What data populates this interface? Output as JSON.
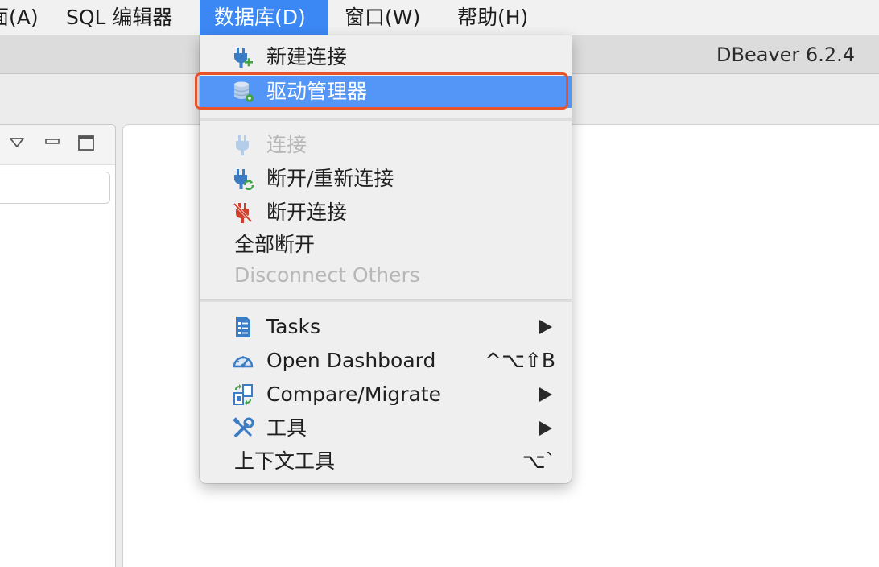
{
  "menubar": {
    "items": [
      {
        "label": "面(A)"
      },
      {
        "label": "SQL 编辑器"
      },
      {
        "label": "数据库(D)"
      },
      {
        "label": "窗口(W)"
      },
      {
        "label": "帮助(H)"
      }
    ]
  },
  "window": {
    "title": "DBeaver 6.2.4"
  },
  "database_menu": {
    "items": [
      {
        "label": "新建连接",
        "icon": "plug-add-icon",
        "enabled": true
      },
      {
        "label": "驱动管理器",
        "icon": "database-driver-icon",
        "enabled": true,
        "highlighted": true
      },
      {
        "label": "连接",
        "icon": "plug-connect-icon",
        "enabled": false
      },
      {
        "label": "断开/重新连接",
        "icon": "plug-reconnect-icon",
        "enabled": true
      },
      {
        "label": "断开连接",
        "icon": "plug-disconnect-icon",
        "enabled": true
      },
      {
        "label": "全部断开",
        "enabled": true
      },
      {
        "label": "Disconnect Others",
        "enabled": false
      },
      {
        "label": "Tasks",
        "icon": "tasks-icon",
        "enabled": true,
        "submenu": true
      },
      {
        "label": "Open Dashboard",
        "icon": "dashboard-icon",
        "enabled": true,
        "shortcut": "^⌥⇧B"
      },
      {
        "label": "Compare/Migrate",
        "icon": "compare-icon",
        "enabled": true,
        "submenu": true
      },
      {
        "label": "工具",
        "icon": "tools-icon",
        "enabled": true,
        "submenu": true
      },
      {
        "label": "上下文工具",
        "enabled": true,
        "shortcut": "⌥`"
      }
    ]
  },
  "colors": {
    "menu_highlight": "#5396f7",
    "active_menubar": "#3b88f5",
    "callout_border": "#e8542a",
    "icon_blue": "#3b7cc4",
    "icon_green": "#45a347",
    "icon_red": "#d0402f"
  }
}
